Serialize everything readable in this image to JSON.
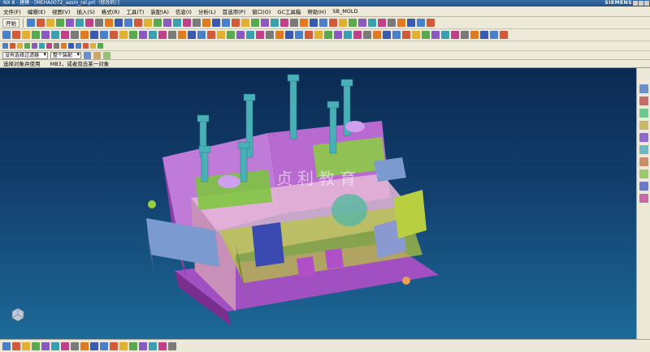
{
  "titlebar": {
    "app_name": "NX 8 - 建模 - [MEHA0072_assm_rel.prt（修改的）]",
    "brand": "SIEMENS"
  },
  "menubar": {
    "items": [
      "文件(F)",
      "编辑(E)",
      "视图(V)",
      "插入(S)",
      "格式(R)",
      "工具(T)",
      "装配(A)",
      "信息(I)",
      "分析(L)",
      "首选项(P)",
      "窗口(O)",
      "GC工具箱",
      "帮助(H)",
      "SB_MOLD"
    ]
  },
  "toolbar": {
    "start_label": "开始"
  },
  "selection_bar": {
    "filter_label": "没有选择过滤器",
    "scope_label": "整个装配"
  },
  "cue_line": {
    "prompt": "选择对象并使用",
    "hint": "MB3，或者双击某一对象"
  },
  "viewport": {
    "watermark": "贞利教育"
  },
  "icons": {
    "toolbar_row1": [
      "start-icon",
      "new-icon",
      "open-icon",
      "save-icon",
      "cut-icon",
      "copy-icon",
      "paste-icon",
      "undo-icon",
      "redo-icon",
      "fit-icon",
      "zoom-icon",
      "rotate-icon",
      "pan-icon",
      "shaded-icon",
      "wireframe-icon",
      "layer-icon",
      "view-icon",
      "measure-icon",
      "sketch-icon",
      "extrude-icon",
      "revolve-icon",
      "hole-icon",
      "boss-icon",
      "pocket-icon",
      "blend-icon",
      "chamfer-icon",
      "shell-icon",
      "trim-icon",
      "unite-icon",
      "subtract-icon",
      "intersect-icon",
      "mirror-icon",
      "pattern-icon",
      "datum-icon",
      "csys-icon",
      "point-icon",
      "plane-icon",
      "axis-icon",
      "offset-icon",
      "move-icon",
      "scale-icon",
      "draft-icon"
    ],
    "toolbar_row2": [
      "assembly-icon",
      "component-icon",
      "constraint-icon",
      "explode-icon",
      "mold-wizard-icon",
      "core-icon",
      "cavity-icon",
      "parting-icon",
      "slider-icon",
      "lifter-icon",
      "ejector-icon",
      "cooling-icon",
      "runner-icon",
      "gate-icon",
      "standard-part-icon",
      "mold-base-icon",
      "electrode-icon",
      "bom-icon",
      "drawing-icon",
      "check-icon",
      "analysis-icon",
      "section-icon",
      "color-icon",
      "render-icon",
      "light-icon",
      "material-icon",
      "texture-icon",
      "animation-icon",
      "motion-icon",
      "simulation-icon",
      "report-icon",
      "export-icon"
    ],
    "bottom_bar": [
      "snap-icon",
      "point-icon",
      "line-icon",
      "arc-icon",
      "circle-icon",
      "rectangle-icon",
      "polygon-icon",
      "spline-icon",
      "fillet-icon",
      "chamfer-icon",
      "trim-icon",
      "extend-icon",
      "offset-icon",
      "mirror-icon",
      "dimension-icon",
      "constraint-icon",
      "measure-icon",
      "text-icon"
    ]
  }
}
